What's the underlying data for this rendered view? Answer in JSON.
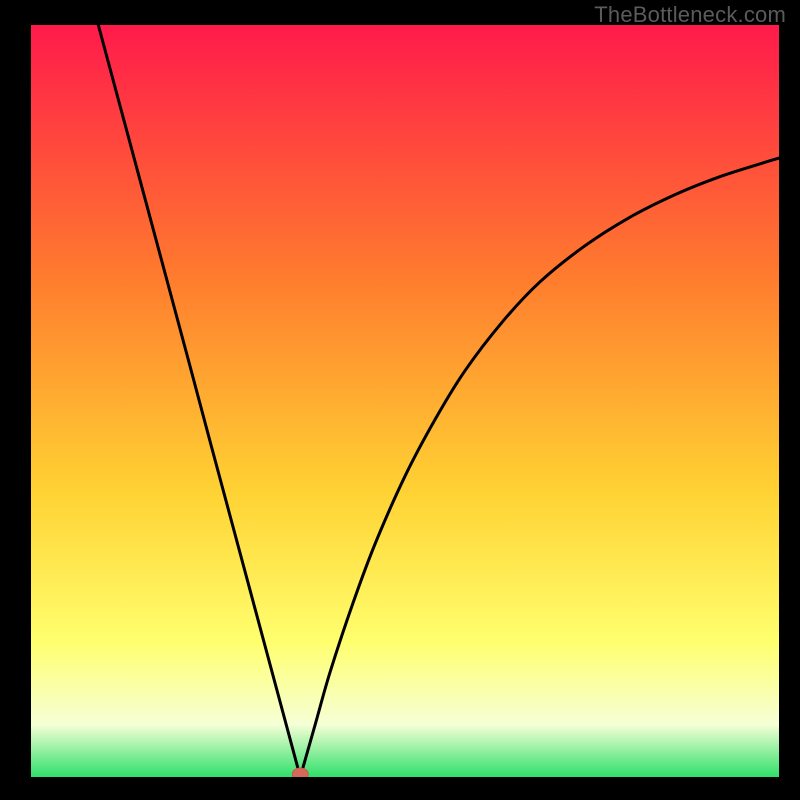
{
  "watermark": "TheBottleneck.com",
  "colors": {
    "bg": "#000000",
    "curve": "#000000",
    "marker_fill": "#d56a5b",
    "marker_stroke": "#c85a4c",
    "grad_top": "#ff1a4b",
    "grad_mid1": "#ff7a2e",
    "grad_mid2": "#ffd233",
    "grad_low_yellow": "#ffff6e",
    "grad_pale": "#f6ffd6",
    "grad_green": "#2fe06a"
  },
  "chart_data": {
    "type": "line",
    "title": "",
    "xlabel": "",
    "ylabel": "",
    "xlim": [
      0,
      100
    ],
    "ylim": [
      0,
      100
    ],
    "minimum": {
      "x": 36,
      "y": 0
    },
    "series": [
      {
        "name": "left-branch",
        "x": [
          9,
          12,
          15,
          18,
          21,
          24,
          27,
          30,
          33,
          36
        ],
        "y": [
          100,
          88.9,
          77.8,
          66.7,
          55.6,
          44.4,
          33.3,
          22.2,
          11.1,
          0
        ]
      },
      {
        "name": "right-branch",
        "x": [
          36,
          38,
          40,
          43,
          46,
          50,
          54,
          58,
          63,
          68,
          74,
          80,
          86,
          92,
          98,
          100
        ],
        "y": [
          0,
          7,
          14,
          23,
          31,
          40,
          47.5,
          54,
          60.5,
          65.8,
          70.6,
          74.4,
          77.4,
          79.8,
          81.7,
          82.3
        ]
      }
    ],
    "background_gradient": {
      "stops": [
        {
          "offset": 0.0,
          "color": "#ff1a4b"
        },
        {
          "offset": 0.33,
          "color": "#ff7a2e"
        },
        {
          "offset": 0.62,
          "color": "#ffd233"
        },
        {
          "offset": 0.82,
          "color": "#ffff6e"
        },
        {
          "offset": 0.93,
          "color": "#f6ffd6"
        },
        {
          "offset": 1.0,
          "color": "#2fe06a"
        }
      ]
    }
  }
}
